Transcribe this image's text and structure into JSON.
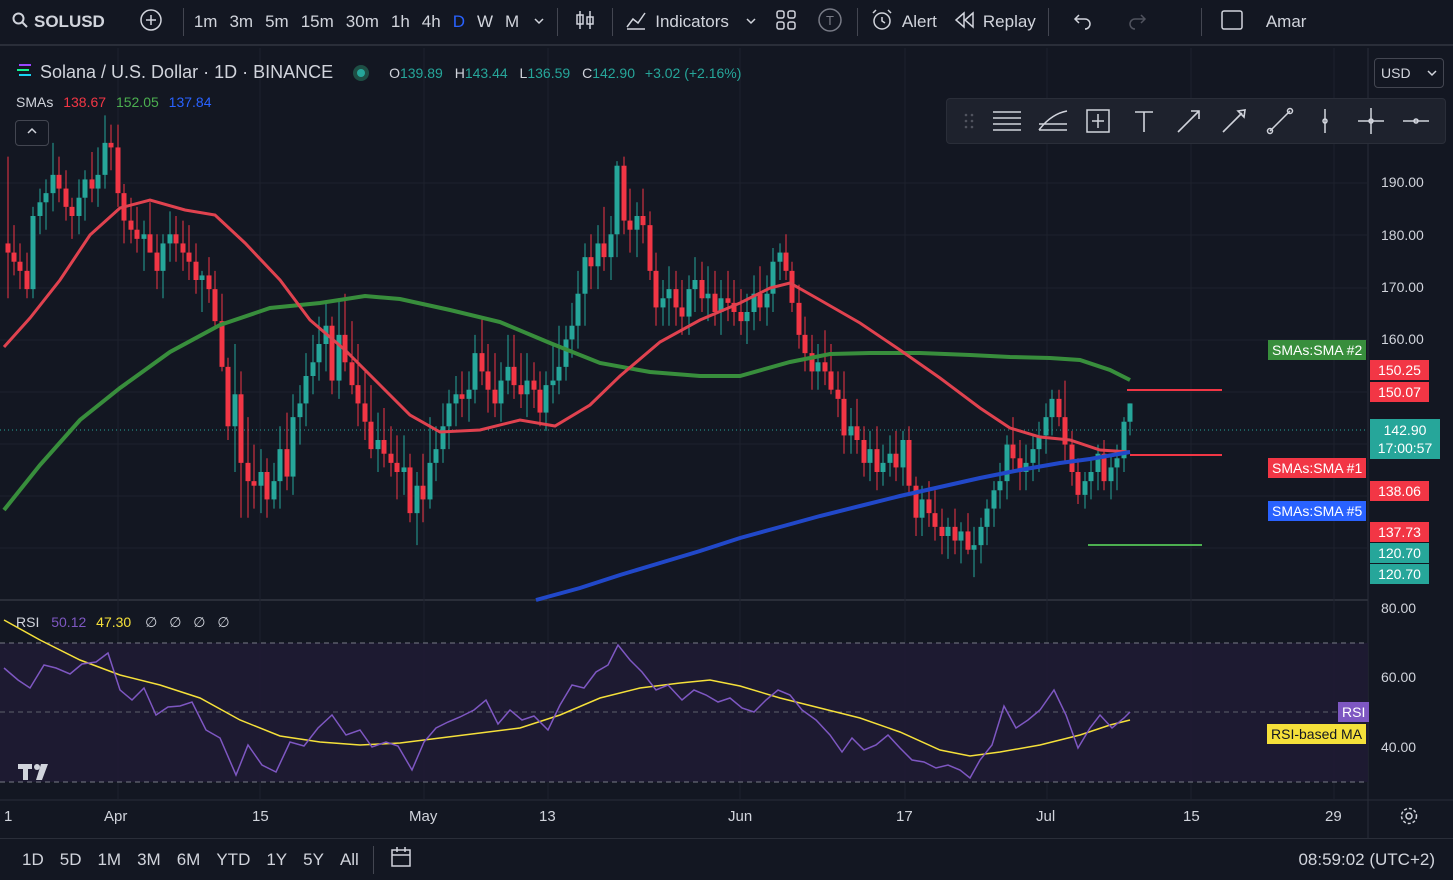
{
  "topbar": {
    "symbol": "SOLUSD",
    "timeframes": [
      "1m",
      "3m",
      "5m",
      "15m",
      "30m",
      "1h",
      "4h",
      "D",
      "W",
      "M"
    ],
    "active_timeframe": "D",
    "indicators_label": "Indicators",
    "alert_label": "Alert",
    "replay_label": "Replay",
    "account_label": "Amar"
  },
  "legend": {
    "title": "Solana / U.S. Dollar · 1D · BINANCE",
    "o_label": "O",
    "o_value": "139.89",
    "h_label": "H",
    "h_value": "143.44",
    "l_label": "L",
    "l_value": "136.59",
    "c_label": "C",
    "c_value": "142.90",
    "change": "+3.02 (+2.16%)",
    "sma_name": "SMAs",
    "sma1": "138.67",
    "sma2": "152.05",
    "sma5": "137.84",
    "rsi_name": "RSI",
    "rsi_value": "50.12",
    "rsi_ma_value": "47.30",
    "rsi_extras": [
      "∅",
      "∅",
      "∅",
      "∅"
    ]
  },
  "currency": "USD",
  "price_axis": [
    "190.00",
    "180.00",
    "170.00",
    "160.00",
    "80.00"
  ],
  "rsi_axis": [
    "60.00",
    "40.00"
  ],
  "price_tags": {
    "sma2_label": "SMAs:SMA #2",
    "tag_150_25": "150.25",
    "tag_150_07": "150.07",
    "last_price": "142.90",
    "countdown": "17:00:57",
    "sma1_label": "SMAs:SMA #1",
    "tag_138_06": "138.06",
    "sma5_label": "SMAs:SMA #5",
    "tag_137_73": "137.73",
    "tag_120_70a": "120.70",
    "tag_120_70b": "120.70",
    "rsi_tag": "RSI",
    "rsi_ma_tag": "RSI-based MA"
  },
  "date_axis": [
    "1",
    "Apr",
    "15",
    "May",
    "13",
    "Jun",
    "17",
    "Jul",
    "15",
    "29"
  ],
  "bottombar": {
    "ranges": [
      "1D",
      "5D",
      "1M",
      "3M",
      "6M",
      "YTD",
      "1Y",
      "5Y",
      "All"
    ],
    "clock": "08:59:02 (UTC+2)"
  },
  "colors": {
    "up": "#26a69a",
    "down": "#f23645",
    "sma1": "#e0424f",
    "sma2": "#388e3c",
    "sma5": "#2148c9",
    "rsi": "#7e57c2",
    "rsi_ma": "#f5e03a",
    "bg": "#131722"
  },
  "chart_data": {
    "type": "candlestick",
    "title": "Solana / U.S. Dollar · 1D · BINANCE",
    "ylim": [
      113,
      200
    ],
    "last_close": 142.9,
    "series": [
      {
        "name": "SMAs:SMA #1",
        "value": 138.67
      },
      {
        "name": "SMAs:SMA #2",
        "value": 152.05
      },
      {
        "name": "SMAs:SMA #5",
        "value": 137.84
      }
    ],
    "rsi": {
      "ylim": [
        30,
        80
      ],
      "value": 50.12,
      "ma": 47.3,
      "levels": [
        70,
        50,
        30
      ]
    }
  }
}
